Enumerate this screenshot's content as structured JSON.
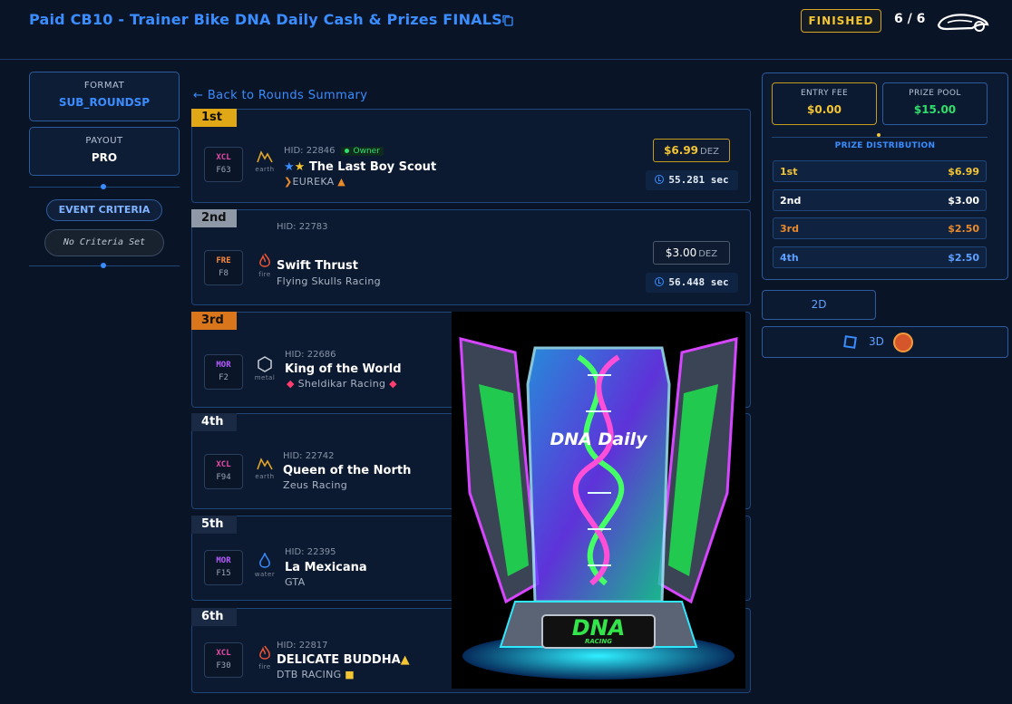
{
  "header": {
    "title": "Paid CB10 - Trainer Bike DNA Daily Cash & Prizes FINALS",
    "status": "FINISHED",
    "count": "6 / 6"
  },
  "sidebar": {
    "format_label": "FORMAT",
    "format_value": "SUB_ROUNDSP",
    "payout_label": "PAYOUT",
    "payout_value": "PRO",
    "event_criteria": "EVENT CRITERIA",
    "no_criteria": "No Criteria Set"
  },
  "back_link": "Back to Rounds Summary",
  "races": [
    {
      "place": "1st",
      "cls": "XCL",
      "grade": "F63",
      "element": "earth",
      "hid": "HID: 22846",
      "owner": "Owner",
      "name": "The Last Boy Scout",
      "stable": "EUREKA",
      "prize": "$6.99",
      "currency": "DEZ",
      "time": "55.281 sec"
    },
    {
      "place": "2nd",
      "cls": "FRE",
      "grade": "F8",
      "element": "fire",
      "hid": "HID: 22783",
      "name": "Swift Thrust",
      "stable": "Flying Skulls Racing",
      "prize": "$3.00",
      "currency": "DEZ",
      "time": "56.448 sec"
    },
    {
      "place": "3rd",
      "cls": "MOR",
      "grade": "F2",
      "element": "metal",
      "hid": "HID: 22686",
      "name": "King of the World",
      "stable": "Sheldikar Racing"
    },
    {
      "place": "4th",
      "cls": "XCL",
      "grade": "F94",
      "element": "earth",
      "hid": "HID: 22742",
      "name": "Queen of the North",
      "stable": "Zeus Racing"
    },
    {
      "place": "5th",
      "cls": "MOR",
      "grade": "F15",
      "element": "water",
      "hid": "HID: 22395",
      "name": "La Mexicana",
      "stable": "GTA"
    },
    {
      "place": "6th",
      "cls": "XCL",
      "grade": "F30",
      "element": "fire",
      "hid": "HID: 22817",
      "name": "DELICATE BUDDHA",
      "stable": "DTB RACING"
    }
  ],
  "trophy": {
    "headline": "DNA Daily",
    "badge": "DNA",
    "badge_sub": "RACING"
  },
  "panel": {
    "entry_fee_label": "ENTRY FEE",
    "entry_fee": "$0.00",
    "prize_pool_label": "PRIZE POOL",
    "prize_pool": "$15.00",
    "distribution_label": "PRIZE DISTRIBUTION",
    "distribution": [
      {
        "place": "1st",
        "amount": "$6.99"
      },
      {
        "place": "2nd",
        "amount": "$3.00"
      },
      {
        "place": "3rd",
        "amount": "$2.50"
      },
      {
        "place": "4th",
        "amount": "$2.50"
      }
    ]
  },
  "views": {
    "two_d": "2D",
    "three_d": "3D"
  },
  "colors": {
    "accent": "#3a8dff",
    "gold": "#e0a816",
    "silver": "#8f98a6",
    "bronze": "#d9761c",
    "green": "#2ee06b",
    "dark": "#0a1427"
  }
}
